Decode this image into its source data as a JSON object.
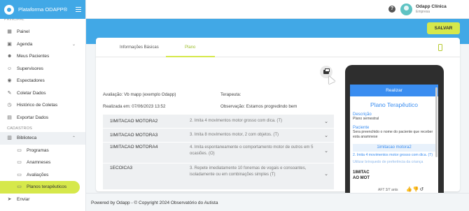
{
  "brand": {
    "name": "Plataforma ODAPP®"
  },
  "sidebar": {
    "section_cut": "PRINCIPAL",
    "items": [
      {
        "label": "Painel",
        "icon": "grid-icon"
      },
      {
        "label": "Agenda",
        "icon": "calendar-icon"
      },
      {
        "label": "Meus Pacientes",
        "icon": "users-icon"
      },
      {
        "label": "Supervisores",
        "icon": "supervisor-icon"
      },
      {
        "label": "Espectadores",
        "icon": "eye-icon"
      },
      {
        "label": "Coletar Dados",
        "icon": "pencil-icon"
      },
      {
        "label": "Histórico de Coletas",
        "icon": "history-icon"
      },
      {
        "label": "Exportar Dados",
        "icon": "export-icon"
      }
    ],
    "section_label": "CADASTROS",
    "library": {
      "label": "Biblioteca",
      "icon": "book-icon"
    },
    "sub_items": [
      {
        "label": "Programas",
        "icon": "doc-icon"
      },
      {
        "label": "Anamneses",
        "icon": "doc-icon"
      },
      {
        "label": "Avaliações",
        "icon": "doc-icon"
      },
      {
        "label": "Planos terapêuticos",
        "icon": "doc-icon"
      }
    ],
    "send": {
      "label": "Enviar",
      "icon": "send-icon"
    }
  },
  "topbar": {
    "user_name": "Odapp Clínica",
    "user_role": "Empresa"
  },
  "toolbar": {
    "save_label": "SALVAR"
  },
  "tabs": {
    "basic": "Informações Básicas",
    "plano": "Plano"
  },
  "meta": {
    "avaliacao": "Avaliação: Vb mapp (exemplo Odapp)",
    "realizada": "Realizada em: 07/06/2023 13:52",
    "terapeuta": "Terapeuta:",
    "observacao": "Observação: Estamos progredindo bem"
  },
  "goals": [
    {
      "name": "1IMITACAO MOTORA2",
      "desc": "2. Imita 4 movimentos motor grosso com dica. (T)"
    },
    {
      "name": "1IMITACAO MOTORA3",
      "desc": "3. Imita 8 movimentos motor, 2 com objetos. (T)"
    },
    {
      "name": "1IMITACAO MOTORA4",
      "desc": "4. Imita espontaneamente o comportamento motor de outros em 5 ocasiões. (O)"
    },
    {
      "name": "1ECOICA3",
      "desc": "3. Repete imediatamente 10 fonemas de vogais e consoantes, isoladamente ou em combinações simples (T)"
    }
  ],
  "preview": {
    "header": "Realizar",
    "title": "Plano Terapêutico",
    "desc_label": "Descrição",
    "desc_text": "Plano semestral",
    "patient_label": "Paciente",
    "patient_text": "Sera preenchido o nome do paciente que receber esta anamnese",
    "goal_title": "1imitacao motora2",
    "goal_text": "2. Imita 4 movimentos motor grosso com dica. (T)",
    "goal_hint": "Utilizar brinquedo de preferência da criança",
    "bottom_name": "1IMITAC AO MOT",
    "bottom_small": "AFT 3/7 ants",
    "actions": "👍👎↺"
  },
  "footer": {
    "text": "Powered by Odapp - © Copyright 2024 Observatório do Autista"
  }
}
